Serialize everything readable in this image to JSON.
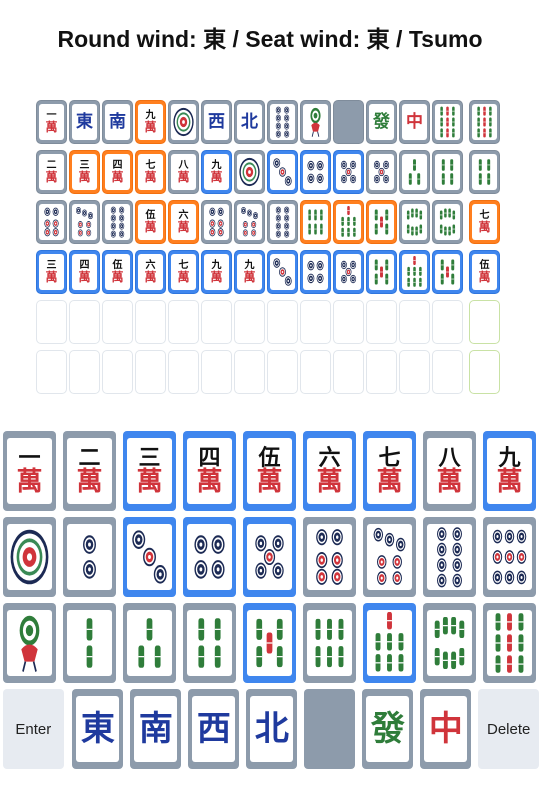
{
  "title": "Round wind: 東 / Seat wind: 東 / Tsumo",
  "colors": {
    "grey": "#8d9bab",
    "orange": "#ff7f1f",
    "blue": "#3f86ee"
  },
  "grid_rows": [
    [
      {
        "tile": "m1",
        "color": "grey"
      },
      {
        "tile": "E",
        "color": "grey"
      },
      {
        "tile": "S",
        "color": "grey"
      },
      {
        "tile": "m9",
        "color": "orange"
      },
      {
        "tile": "p1",
        "color": "grey"
      },
      {
        "tile": "W",
        "color": "grey"
      },
      {
        "tile": "N",
        "color": "grey"
      },
      {
        "tile": "p8",
        "color": "grey"
      },
      {
        "tile": "s1",
        "color": "grey"
      },
      {
        "tile": "Wh",
        "color": "grey"
      },
      {
        "tile": "G",
        "color": "grey"
      },
      {
        "tile": "R",
        "color": "grey"
      },
      {
        "tile": "s9",
        "color": "grey"
      },
      {
        "tile": "s9",
        "color": "grey"
      }
    ],
    [
      {
        "tile": "m2",
        "color": "grey"
      },
      {
        "tile": "m3",
        "color": "orange"
      },
      {
        "tile": "m4",
        "color": "orange"
      },
      {
        "tile": "m7",
        "color": "orange"
      },
      {
        "tile": "m8",
        "color": "grey"
      },
      {
        "tile": "m9",
        "color": "blue"
      },
      {
        "tile": "p1",
        "color": "grey"
      },
      {
        "tile": "p3",
        "color": "blue"
      },
      {
        "tile": "p4",
        "color": "blue"
      },
      {
        "tile": "p5",
        "color": "blue"
      },
      {
        "tile": "p5",
        "color": "grey"
      },
      {
        "tile": "s3",
        "color": "grey"
      },
      {
        "tile": "s4",
        "color": "grey"
      },
      {
        "tile": "s4",
        "color": "grey"
      }
    ],
    [
      {
        "tile": "p6",
        "color": "grey"
      },
      {
        "tile": "p7",
        "color": "grey"
      },
      {
        "tile": "p8",
        "color": "grey"
      },
      {
        "tile": "m5",
        "color": "orange"
      },
      {
        "tile": "m6",
        "color": "orange"
      },
      {
        "tile": "p6",
        "color": "grey"
      },
      {
        "tile": "p7",
        "color": "grey"
      },
      {
        "tile": "p8",
        "color": "grey"
      },
      {
        "tile": "s6",
        "color": "orange"
      },
      {
        "tile": "s7",
        "color": "orange"
      },
      {
        "tile": "s5",
        "color": "orange"
      },
      {
        "tile": "s8",
        "color": "grey"
      },
      {
        "tile": "s8",
        "color": "grey"
      },
      {
        "tile": "m7",
        "color": "orange"
      }
    ],
    [
      {
        "tile": "m3",
        "color": "blue"
      },
      {
        "tile": "m4",
        "color": "blue"
      },
      {
        "tile": "m5",
        "color": "blue"
      },
      {
        "tile": "m6",
        "color": "blue"
      },
      {
        "tile": "m7",
        "color": "blue"
      },
      {
        "tile": "m9",
        "color": "blue"
      },
      {
        "tile": "m9",
        "color": "blue"
      },
      {
        "tile": "p3",
        "color": "blue"
      },
      {
        "tile": "p4",
        "color": "blue"
      },
      {
        "tile": "p5",
        "color": "blue"
      },
      {
        "tile": "s5",
        "color": "blue"
      },
      {
        "tile": "s7",
        "color": "blue"
      },
      {
        "tile": "s5",
        "color": "blue"
      },
      {
        "tile": "m5",
        "color": "blue"
      }
    ],
    [
      {
        "tile": "",
        "color": "empty"
      },
      {
        "tile": "",
        "color": "empty"
      },
      {
        "tile": "",
        "color": "empty"
      },
      {
        "tile": "",
        "color": "empty"
      },
      {
        "tile": "",
        "color": "empty"
      },
      {
        "tile": "",
        "color": "empty"
      },
      {
        "tile": "",
        "color": "empty"
      },
      {
        "tile": "",
        "color": "empty"
      },
      {
        "tile": "",
        "color": "empty"
      },
      {
        "tile": "",
        "color": "empty"
      },
      {
        "tile": "",
        "color": "empty"
      },
      {
        "tile": "",
        "color": "empty"
      },
      {
        "tile": "",
        "color": "empty"
      },
      {
        "tile": "",
        "color": "empty-green"
      }
    ],
    [
      {
        "tile": "",
        "color": "empty"
      },
      {
        "tile": "",
        "color": "empty"
      },
      {
        "tile": "",
        "color": "empty"
      },
      {
        "tile": "",
        "color": "empty"
      },
      {
        "tile": "",
        "color": "empty"
      },
      {
        "tile": "",
        "color": "empty"
      },
      {
        "tile": "",
        "color": "empty"
      },
      {
        "tile": "",
        "color": "empty"
      },
      {
        "tile": "",
        "color": "empty"
      },
      {
        "tile": "",
        "color": "empty"
      },
      {
        "tile": "",
        "color": "empty"
      },
      {
        "tile": "",
        "color": "empty"
      },
      {
        "tile": "",
        "color": "empty"
      },
      {
        "tile": "",
        "color": "empty-green"
      }
    ]
  ],
  "keyboard": {
    "man": [
      {
        "tile": "m1",
        "color": "grey"
      },
      {
        "tile": "m2",
        "color": "grey"
      },
      {
        "tile": "m3",
        "color": "blue"
      },
      {
        "tile": "m4",
        "color": "blue"
      },
      {
        "tile": "m5",
        "color": "blue"
      },
      {
        "tile": "m6",
        "color": "blue"
      },
      {
        "tile": "m7",
        "color": "blue"
      },
      {
        "tile": "m8",
        "color": "grey"
      },
      {
        "tile": "m9",
        "color": "blue"
      }
    ],
    "pin": [
      {
        "tile": "p1",
        "color": "grey"
      },
      {
        "tile": "p2",
        "color": "grey"
      },
      {
        "tile": "p3",
        "color": "blue"
      },
      {
        "tile": "p4",
        "color": "blue"
      },
      {
        "tile": "p5",
        "color": "blue"
      },
      {
        "tile": "p6",
        "color": "grey"
      },
      {
        "tile": "p7",
        "color": "grey"
      },
      {
        "tile": "p8",
        "color": "grey"
      },
      {
        "tile": "p9",
        "color": "grey"
      }
    ],
    "sou": [
      {
        "tile": "s1",
        "color": "grey"
      },
      {
        "tile": "s2",
        "color": "grey"
      },
      {
        "tile": "s3",
        "color": "grey"
      },
      {
        "tile": "s4",
        "color": "grey"
      },
      {
        "tile": "s5",
        "color": "blue"
      },
      {
        "tile": "s6",
        "color": "grey"
      },
      {
        "tile": "s7",
        "color": "blue"
      },
      {
        "tile": "s8",
        "color": "grey"
      },
      {
        "tile": "s9",
        "color": "grey"
      }
    ],
    "honors": [
      {
        "tile": "E",
        "color": "grey"
      },
      {
        "tile": "S",
        "color": "grey"
      },
      {
        "tile": "W",
        "color": "grey"
      },
      {
        "tile": "N",
        "color": "grey"
      },
      {
        "tile": "Wh",
        "color": "grey"
      },
      {
        "tile": "G",
        "color": "grey"
      },
      {
        "tile": "R",
        "color": "grey"
      }
    ],
    "enter_label": "Enter",
    "delete_label": "Delete"
  },
  "tile_glyphs": {
    "man_numerals": {
      "1": "一",
      "2": "二",
      "3": "三",
      "4": "四",
      "5": "伍",
      "6": "六",
      "7": "七",
      "8": "八",
      "9": "九"
    },
    "man_suit": "萬",
    "E": "東",
    "S": "南",
    "W": "西",
    "N": "北",
    "G": "發",
    "R": "中"
  }
}
